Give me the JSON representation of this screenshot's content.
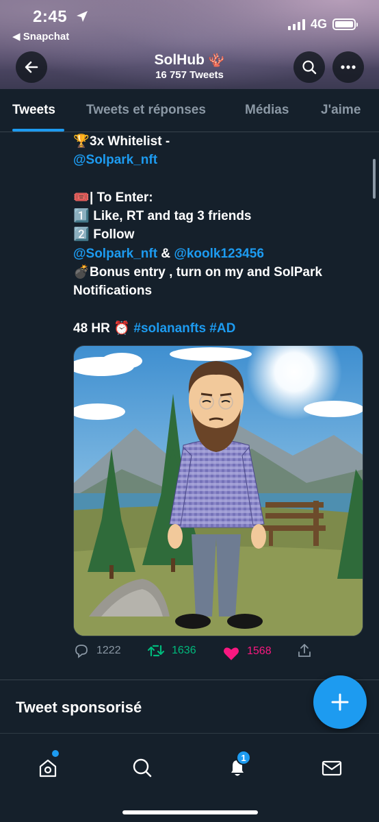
{
  "status_bar": {
    "time": "2:45",
    "back_app": "◀ Snapchat",
    "network": "4G"
  },
  "header": {
    "title": "SolHub",
    "title_emoji": "🪸",
    "tweets_count": "16 757 Tweets",
    "icons": [
      "arrow-left-icon",
      "search-icon",
      "more-icon"
    ]
  },
  "tabs": [
    {
      "label": "Tweets",
      "active": true
    },
    {
      "label": "Tweets et réponses",
      "active": false
    },
    {
      "label": "Médias",
      "active": false
    },
    {
      "label": "J'aime",
      "active": false
    }
  ],
  "tweet": {
    "lines": {
      "l1": {
        "emoji": "🏆",
        "text": "3x Whitelist -"
      },
      "l2": {
        "mention": "@Solpark_nft"
      },
      "l3": {
        "emoji": "🎟️",
        "text": "| To Enter:"
      },
      "l4": {
        "emoji": "1️⃣",
        "text": "Like, RT and tag 3 friends"
      },
      "l5": {
        "emoji": "2️⃣",
        "text": "Follow"
      },
      "l6": {
        "mention1": "@Solpark_nft",
        "amp": " & ",
        "mention2": "@koolk123456"
      },
      "l7": {
        "emoji": "💣",
        "text": "Bonus entry , turn on my and SolPark"
      },
      "l8": {
        "text": "Notifications"
      },
      "l9": {
        "text": "48 HR",
        "emoji": "⏰",
        "hashtag1": "#solananfts",
        "hashtag2": "#AD"
      }
    },
    "stats": {
      "replies": "1222",
      "retweets": "1636",
      "likes": "1568"
    }
  },
  "sponsored_label": "Tweet sponsorisé",
  "bottom_nav": {
    "items": [
      "home-icon",
      "search-icon",
      "notifications-icon",
      "messages-icon"
    ],
    "notifications_badge": "1"
  },
  "colors": {
    "background": "#15202b",
    "accent": "#1d9bf0",
    "retweet": "#00ba7c",
    "like": "#f91880",
    "muted": "#8b98a5"
  }
}
